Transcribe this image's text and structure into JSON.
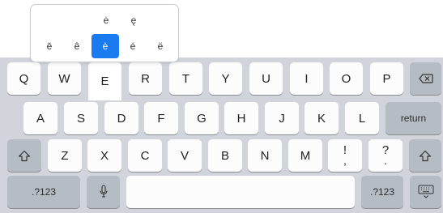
{
  "accent_popup": {
    "top_row": [
      "ė",
      "ę"
    ],
    "bottom_row": [
      "ē",
      "ê",
      "è",
      "é",
      "ë"
    ],
    "selected": "è"
  },
  "keyboard": {
    "row1": [
      "Q",
      "W",
      "E",
      "R",
      "T",
      "Y",
      "U",
      "I",
      "O",
      "P"
    ],
    "row2": [
      "A",
      "S",
      "D",
      "F",
      "G",
      "H",
      "J",
      "K",
      "L"
    ],
    "row3": [
      "Z",
      "X",
      "C",
      "V",
      "B",
      "N",
      "M"
    ],
    "return_label": "return",
    "exclaim_top": "!",
    "exclaim_bottom": ",",
    "question_top": "?",
    "question_bottom": ".",
    "numbers_label_left": ".?123",
    "numbers_label_right": ".?123",
    "icons": {
      "delete": "delete-icon",
      "shift": "shift-icon",
      "microphone": "microphone-icon",
      "hide_keyboard": "hide-keyboard-icon"
    },
    "colors": {
      "background": "#d1d5db",
      "letter_key": "#fcfcfd",
      "function_key": "#b6bcc4",
      "selection": "#1a7af0"
    }
  }
}
